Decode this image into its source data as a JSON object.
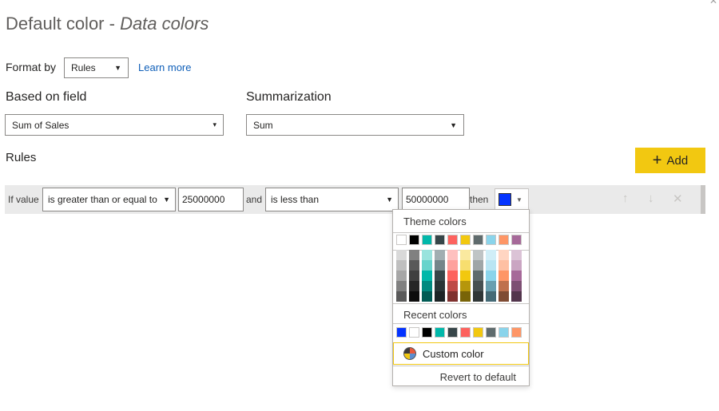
{
  "title": {
    "prefix": "Default color - ",
    "italic": "Data colors"
  },
  "format_by": {
    "label": "Format by",
    "value": "Rules",
    "learn_more": "Learn more"
  },
  "based_on": {
    "label": "Based on field",
    "value": "Sum of Sales"
  },
  "summarization": {
    "label": "Summarization",
    "value": "Sum"
  },
  "rules": {
    "label": "Rules",
    "add_label": "Add",
    "row": {
      "if_value": "If value",
      "operator1": "is greater than or equal to",
      "value1": "25000000",
      "and": "and",
      "operator2": "is less than",
      "value2": "50000000",
      "then": "then",
      "color": "#0433ff"
    }
  },
  "color_picker": {
    "theme_label": "Theme colors",
    "theme_base": [
      "#ffffff",
      "#000000",
      "#01b8aa",
      "#374649",
      "#fd625e",
      "#f2c80f",
      "#5f6b6d",
      "#8ad4eb",
      "#fe9666",
      "#a66999"
    ],
    "theme_shades": [
      [
        "#d9d9d9",
        "#bfbfbf",
        "#a6a6a6",
        "#808080",
        "#595959"
      ],
      [
        "#808080",
        "#595959",
        "#404040",
        "#262626",
        "#0d0d0d"
      ],
      [
        "#99e3dd",
        "#67d4cc",
        "#01b8aa",
        "#018a80",
        "#015c55"
      ],
      [
        "#a1aeb1",
        "#74868a",
        "#374649",
        "#293537",
        "#1c2325"
      ],
      [
        "#fec0bf",
        "#fea19e",
        "#fd625e",
        "#be4a47",
        "#7f312f"
      ],
      [
        "#fae99f",
        "#f7de6f",
        "#f2c80f",
        "#b6960b",
        "#796408"
      ],
      [
        "#bfc4c5",
        "#9fa6a7",
        "#5f6b6d",
        "#475052",
        "#303637"
      ],
      [
        "#d0eef7",
        "#b9e5f3",
        "#8ad4eb",
        "#689fb0",
        "#456a76"
      ],
      [
        "#ffd5c2",
        "#fec0a3",
        "#fe9666",
        "#bf714d",
        "#7f4b33"
      ],
      [
        "#dbc3d6",
        "#caa5c2",
        "#a66999",
        "#7d4f73",
        "#53354c"
      ]
    ],
    "recent_label": "Recent colors",
    "recent": [
      "#0433ff",
      "#ffffff",
      "#000000",
      "#01b8aa",
      "#374649",
      "#fd625e",
      "#f2c80f",
      "#5f6b6d",
      "#8ad4eb",
      "#fe9666"
    ],
    "custom_label": "Custom color",
    "revert_label": "Revert to default"
  }
}
